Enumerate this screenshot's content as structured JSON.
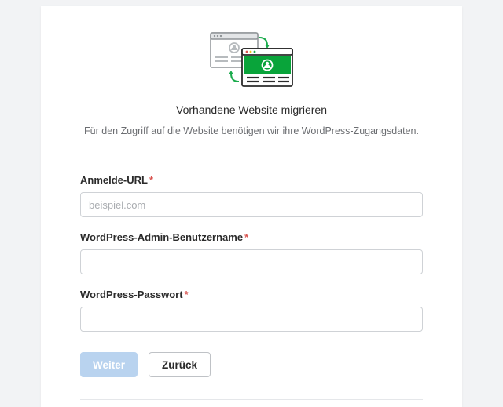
{
  "hero": {
    "title": "Vorhandene Website migrieren",
    "subtitle": "Für den Zugriff auf die Website benötigen wir ihre WordPress-Zugangsdaten."
  },
  "form": {
    "login_url": {
      "label": "Anmelde-URL",
      "placeholder": "beispiel.com",
      "required_mark": "*"
    },
    "username": {
      "label": "WordPress-Admin-Benutzername",
      "required_mark": "*"
    },
    "password": {
      "label": "WordPress-Passwort",
      "required_mark": "*"
    }
  },
  "buttons": {
    "next": "Weiter",
    "back": "Zurück"
  }
}
